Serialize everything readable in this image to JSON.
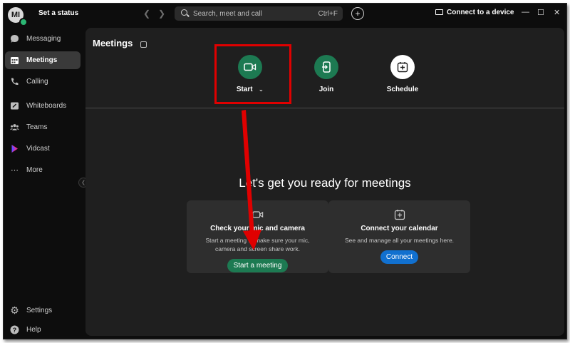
{
  "titlebar": {
    "avatar_initials": "MI",
    "status_label": "Set a status",
    "back_icon": "chevron-left-icon",
    "forward_icon": "chevron-right-icon",
    "search": {
      "placeholder": "Search, meet and call",
      "shortcut": "Ctrl+F"
    },
    "connect_label": "Connect to a device",
    "window_controls": [
      "—",
      "☐",
      "✕"
    ]
  },
  "sidebar": {
    "items": [
      {
        "label": "Messaging",
        "icon": "message-icon"
      },
      {
        "label": "Meetings",
        "icon": "calendar-icon",
        "active": true
      },
      {
        "label": "Calling",
        "icon": "phone-icon"
      },
      {
        "label": "Whiteboards",
        "icon": "whiteboard-icon"
      },
      {
        "label": "Teams",
        "icon": "people-icon"
      },
      {
        "label": "Vidcast",
        "icon": "vidcast-icon"
      },
      {
        "label": "More",
        "icon": "more-icon"
      }
    ],
    "footer": [
      {
        "label": "Settings",
        "icon": "gear-icon"
      },
      {
        "label": "Help",
        "icon": "help-icon"
      }
    ]
  },
  "main": {
    "title": "Meetings",
    "actions": [
      {
        "label": "Start",
        "icon": "video-icon",
        "color": "#1d7a52"
      },
      {
        "label": "Join",
        "icon": "join-icon",
        "color": "#1d7a52"
      },
      {
        "label": "Schedule",
        "icon": "calendar-plus-icon",
        "color": "#ffffff"
      }
    ],
    "hero": "Let's get you ready for meetings",
    "cards": [
      {
        "title": "Check your mic and camera",
        "desc": "Start a meeting to make sure your mic, camera and screen share work.",
        "button": "Start a meeting",
        "icon": "video-icon"
      },
      {
        "title": "Connect your calendar",
        "desc": "See and manage all your meetings here.",
        "button": "Connect",
        "icon": "calendar-plus-icon"
      }
    ]
  },
  "colors": {
    "background": "#0d0d0d",
    "panel": "#1f1f1f",
    "accent_green": "#1d7a52",
    "accent_blue": "#1170cf",
    "annotation_red": "#e00000"
  }
}
